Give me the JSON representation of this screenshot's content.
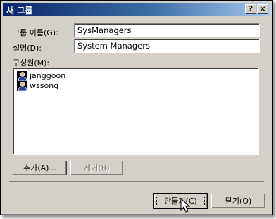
{
  "window": {
    "title": "새 그룹",
    "help_button": "?",
    "close_button": "×"
  },
  "form": {
    "group_name_label": "그룹 이름(G):",
    "group_name_value": "SysManagers",
    "description_label": "설명(D):",
    "description_value": "System Managers",
    "members_label": "구성원(M):"
  },
  "members": [
    {
      "name": "janggoon",
      "icon": "user-icon"
    },
    {
      "name": "wssong",
      "icon": "user-icon"
    }
  ],
  "buttons": {
    "add": "추가(A)...",
    "remove": "제거(R)",
    "create": "만들기(C)",
    "close": "닫기(O)"
  }
}
